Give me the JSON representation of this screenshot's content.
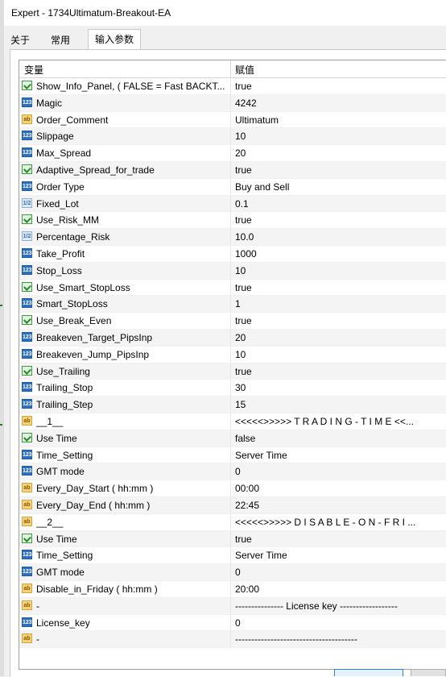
{
  "window": {
    "title": "Expert - 1734Ultimatum-Breakout-EA"
  },
  "tabs": [
    {
      "label": "关于"
    },
    {
      "label": "常用"
    },
    {
      "label": "输入参数"
    }
  ],
  "table": {
    "headers": {
      "variable": "变量",
      "value": "赋值"
    },
    "rows": [
      {
        "type": "bool-icon",
        "name": "Show_Info_Panel, ( FALSE = Fast BACKT...",
        "value": "true"
      },
      {
        "type": "int-icon",
        "name": "Magic",
        "value": "4242"
      },
      {
        "type": "string-icon",
        "name": "Order_Comment",
        "value": "Ultimatum"
      },
      {
        "type": "int-icon",
        "name": "Slippage",
        "value": "10"
      },
      {
        "type": "int-icon",
        "name": "Max_Spread",
        "value": "20"
      },
      {
        "type": "bool-icon",
        "name": "Adaptive_Spread_for_trade",
        "value": "true"
      },
      {
        "type": "int-icon",
        "name": "Order Type",
        "value": "Buy and Sell"
      },
      {
        "type": "double-icon",
        "name": "Fixed_Lot",
        "value": "0.1"
      },
      {
        "type": "bool-icon",
        "name": "Use_Risk_MM",
        "value": "true"
      },
      {
        "type": "double-icon",
        "name": "Percentage_Risk",
        "value": "10.0"
      },
      {
        "type": "int-icon",
        "name": "Take_Profit",
        "value": "1000"
      },
      {
        "type": "int-icon",
        "name": "Stop_Loss",
        "value": "10"
      },
      {
        "type": "bool-icon",
        "name": "Use_Smart_StopLoss",
        "value": "true"
      },
      {
        "type": "int-icon",
        "name": "Smart_StopLoss",
        "value": "1"
      },
      {
        "type": "bool-icon",
        "name": "Use_Break_Even",
        "value": "true"
      },
      {
        "type": "int-icon",
        "name": "Breakeven_Target_PipsInp",
        "value": "20"
      },
      {
        "type": "int-icon",
        "name": "Breakeven_Jump_PipsInp",
        "value": "10"
      },
      {
        "type": "bool-icon",
        "name": "Use_Trailing",
        "value": "true"
      },
      {
        "type": "int-icon",
        "name": "Trailing_Stop",
        "value": "30"
      },
      {
        "type": "int-icon",
        "name": "Trailing_Step",
        "value": "15"
      },
      {
        "type": "string-icon",
        "name": "__1__",
        "value": "<<<<<>>>>> T R A D I N G - T I M E <<..."
      },
      {
        "type": "bool-icon",
        "name": "Use Time",
        "value": "false"
      },
      {
        "type": "int-icon",
        "name": "Time_Setting",
        "value": "Server Time"
      },
      {
        "type": "int-icon",
        "name": "GMT mode",
        "value": "0"
      },
      {
        "type": "string-icon",
        "name": "Every_Day_Start ( hh:mm )",
        "value": "00:00"
      },
      {
        "type": "string-icon",
        "name": "Every_Day_End ( hh:mm )",
        "value": "22:45"
      },
      {
        "type": "string-icon",
        "name": "__2__",
        "value": "<<<<<>>>>> D I S A B L E - O N - F R I ..."
      },
      {
        "type": "bool-icon",
        "name": "Use Time",
        "value": "true"
      },
      {
        "type": "int-icon",
        "name": "Time_Setting",
        "value": "Server Time"
      },
      {
        "type": "int-icon",
        "name": "GMT mode",
        "value": "0"
      },
      {
        "type": "string-icon",
        "name": "Disable_in_Friday ( hh:mm )",
        "value": "20:00"
      },
      {
        "type": "string-icon",
        "name": "-",
        "value": "--------------- License key ------------------"
      },
      {
        "type": "int-icon",
        "name": "License_key",
        "value": "0"
      },
      {
        "type": "string-icon",
        "name": "-",
        "value": "--------------------------------------"
      }
    ]
  },
  "icon_labels": {
    "bool-icon": "",
    "int-icon": "123",
    "double-icon": "1/2",
    "string-icon": "ab"
  }
}
